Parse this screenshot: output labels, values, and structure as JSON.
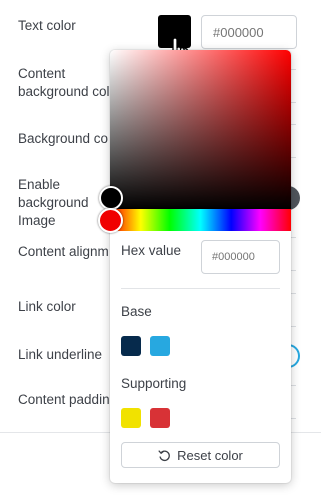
{
  "settings": {
    "text_color": "Text color",
    "content_background_color": "Content background color",
    "background_color": "Background co",
    "enable_background_image": "Enable background Image",
    "content_alignment": "Content alignm",
    "link_color": "Link color",
    "link_underline": "Link underline",
    "content_padding": "Content paddin",
    "text_color_hex_placeholder": "#000000",
    "selected_color": "#000000"
  },
  "picker": {
    "hex_label": "Hex value",
    "hex_placeholder": "#000000",
    "base_label": "Base",
    "base_swatches": [
      "#062a4c",
      "#27a8e0"
    ],
    "supporting_label": "Supporting",
    "supporting_swatches": [
      "#f1e200",
      "#d83236"
    ],
    "reset_label": "Reset color",
    "hue_color": "#ff0000"
  },
  "icons": {
    "cursor": "hand-pointer-icon",
    "reset": "undo-icon"
  }
}
